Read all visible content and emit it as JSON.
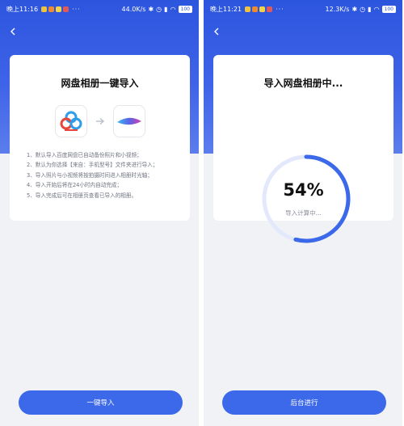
{
  "left_screen": {
    "status": {
      "time": "晚上11:16",
      "more": "···",
      "network": "44.0K/s"
    },
    "card": {
      "title": "网盘相册一键导入",
      "steps": [
        "1、默认导入百度网盘已自动备份照片和小视频；",
        "2、默认为你选择【来自：手机型号】文件夹进行导入；",
        "3、导入照片与小视频将按拍摄时间进入相册时光轴；",
        "4、导入开始后将在24小时内自动完成；",
        "5、导入完成后可在相册页查看已导入的相册。"
      ]
    },
    "button_label": "一键导入"
  },
  "right_screen": {
    "status": {
      "time": "晚上11:21",
      "more": "···",
      "network": "12.3K/s"
    },
    "card": {
      "title": "导入网盘相册中...",
      "progress_label": "54%",
      "progress_value": 0.54,
      "status_text": "导入计算中..."
    },
    "button_label": "后台进行"
  },
  "battery_label": "100",
  "colors": {
    "header": "#2c55de",
    "button": "#3c69e9",
    "ring_progress": "#3c69e9",
    "ring_track": "#e3e9fb",
    "app_dots": [
      "#f0c33c",
      "#ef8a2f",
      "#f3d446",
      "#e05a5a"
    ]
  },
  "icons": {
    "back": "chevron-left-icon",
    "source_app": "baidu-netdisk-logo-icon",
    "target_app": "photo-album-logo-icon",
    "arrow": "arrow-right-icon",
    "status": [
      "bluetooth-icon",
      "alarm-icon",
      "signal-icon",
      "wifi-icon",
      "battery-icon"
    ]
  }
}
